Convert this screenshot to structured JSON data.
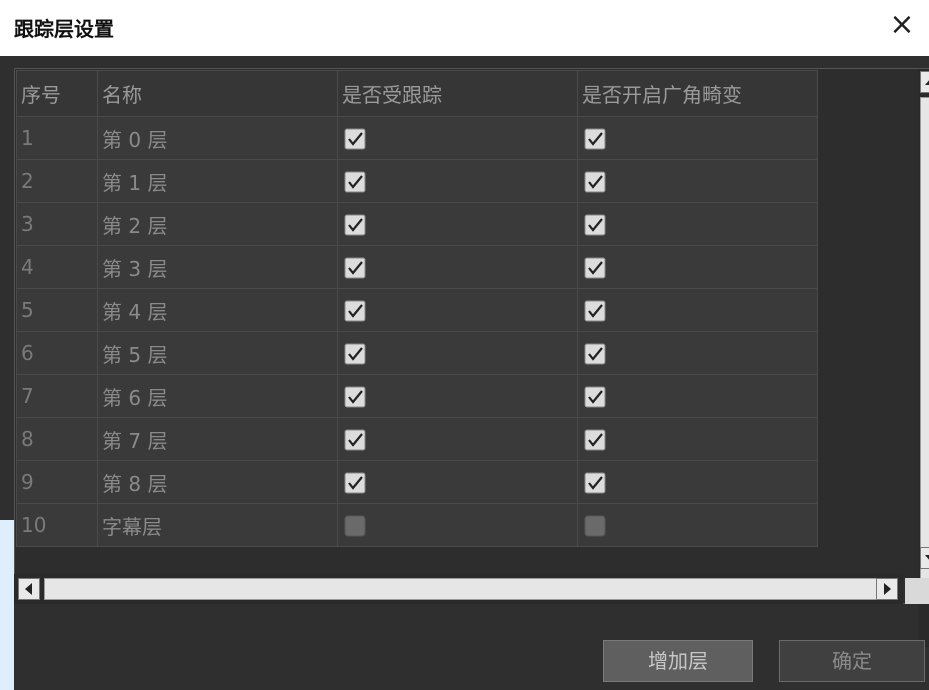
{
  "dialog": {
    "title": "跟踪层设置",
    "close_label": "×"
  },
  "table": {
    "columns": [
      "序号",
      "名称",
      "是否受跟踪",
      "是否开启广角畸变"
    ],
    "rows": [
      {
        "index": "1",
        "name": "第 0 层",
        "tracked": true,
        "wide_angle": true
      },
      {
        "index": "2",
        "name": "第 1 层",
        "tracked": true,
        "wide_angle": true
      },
      {
        "index": "3",
        "name": "第 2 层",
        "tracked": true,
        "wide_angle": true
      },
      {
        "index": "4",
        "name": "第 3 层",
        "tracked": true,
        "wide_angle": true
      },
      {
        "index": "5",
        "name": "第 4 层",
        "tracked": true,
        "wide_angle": true
      },
      {
        "index": "6",
        "name": "第 5 层",
        "tracked": true,
        "wide_angle": true
      },
      {
        "index": "7",
        "name": "第 6 层",
        "tracked": true,
        "wide_angle": true
      },
      {
        "index": "8",
        "name": "第 7 层",
        "tracked": true,
        "wide_angle": true
      },
      {
        "index": "9",
        "name": "第 8 层",
        "tracked": true,
        "wide_angle": true
      },
      {
        "index": "10",
        "name": "字幕层",
        "tracked": false,
        "wide_angle": false
      }
    ]
  },
  "buttons": {
    "add_layer": "增加层",
    "confirm": "确定"
  },
  "icons": {
    "close": "close-icon",
    "checked": "checkbox-checked-icon",
    "unchecked": "checkbox-unchecked-icon",
    "scroll_up": "arrow-up-icon",
    "scroll_down": "arrow-down-icon",
    "scroll_left": "arrow-left-icon",
    "scroll_right": "arrow-right-icon"
  },
  "colors": {
    "background": "#2f2f2f",
    "titlebar": "#ffffff",
    "cell": "#3a3a3a",
    "checkbox": "#dcdcdc"
  }
}
